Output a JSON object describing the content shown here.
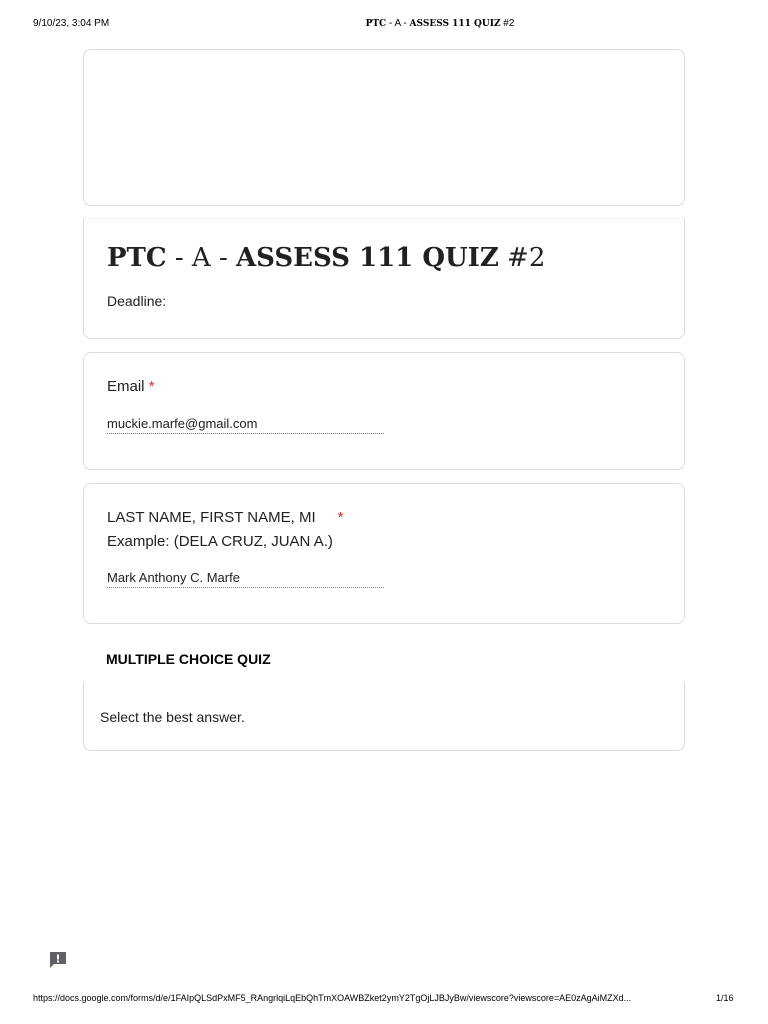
{
  "print_header": {
    "datetime": "9/10/23, 3:04 PM",
    "title_serif_part": "PTC",
    "title_rest": " - A - ",
    "title_serif_part2": "ASSESS 111 QUIZ",
    "title_tail": " #2"
  },
  "form": {
    "title_prefix": "PTC",
    "title_mid": " - A - ",
    "title_main": "ASSESS 111 QUIZ",
    "title_suffix": " #2",
    "deadline_label": "Deadline:"
  },
  "questions": {
    "email": {
      "label": "Email",
      "required_marker": "*",
      "answer": "muckie.marfe@gmail.com"
    },
    "name": {
      "label_line1": "LAST NAME, FIRST NAME, MI",
      "required_marker": "*",
      "label_line2": "Example: (DELA CRUZ, JUAN A.)",
      "answer": "Mark Anthony C. Marfe"
    }
  },
  "section": {
    "title": "MULTIPLE CHOICE QUIZ",
    "description": "Select the best answer."
  },
  "icons": {
    "report": "report-issue-icon"
  },
  "print_footer": {
    "url": "https://docs.google.com/forms/d/e/1FAIpQLSdPxMF5_RAngrlqiLqEbQhTmXOAWBZket2ymY2TgOjLJBJyBw/viewscore?viewscore=AE0zAgAiMZXd...",
    "page": "1/16"
  }
}
